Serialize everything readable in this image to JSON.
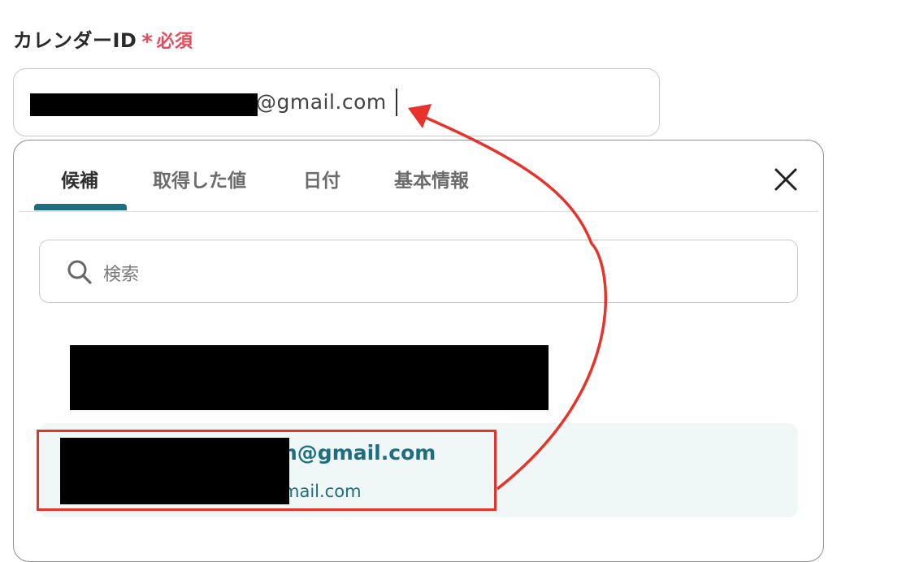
{
  "form": {
    "label": "カレンダーID",
    "required_mark": "*",
    "required_text": "必須",
    "input_value": "@gmail.com"
  },
  "dropdown": {
    "tabs": [
      {
        "label": "候補"
      },
      {
        "label": "取得した値"
      },
      {
        "label": "日付"
      },
      {
        "label": "基本情報"
      }
    ],
    "active_tab": "候補",
    "search_placeholder": "検索",
    "candidates": [
      {
        "primary": "",
        "secondary": ""
      },
      {
        "primary": "n@gmail.com",
        "secondary": "mail.com"
      }
    ]
  },
  "icons": {
    "close": "close-icon",
    "search": "search-icon"
  },
  "colors": {
    "accent": "#1d6e82",
    "required": "#e84b5a",
    "annotation": "#e8332a",
    "highlight_bg": "#f0f8f7"
  }
}
